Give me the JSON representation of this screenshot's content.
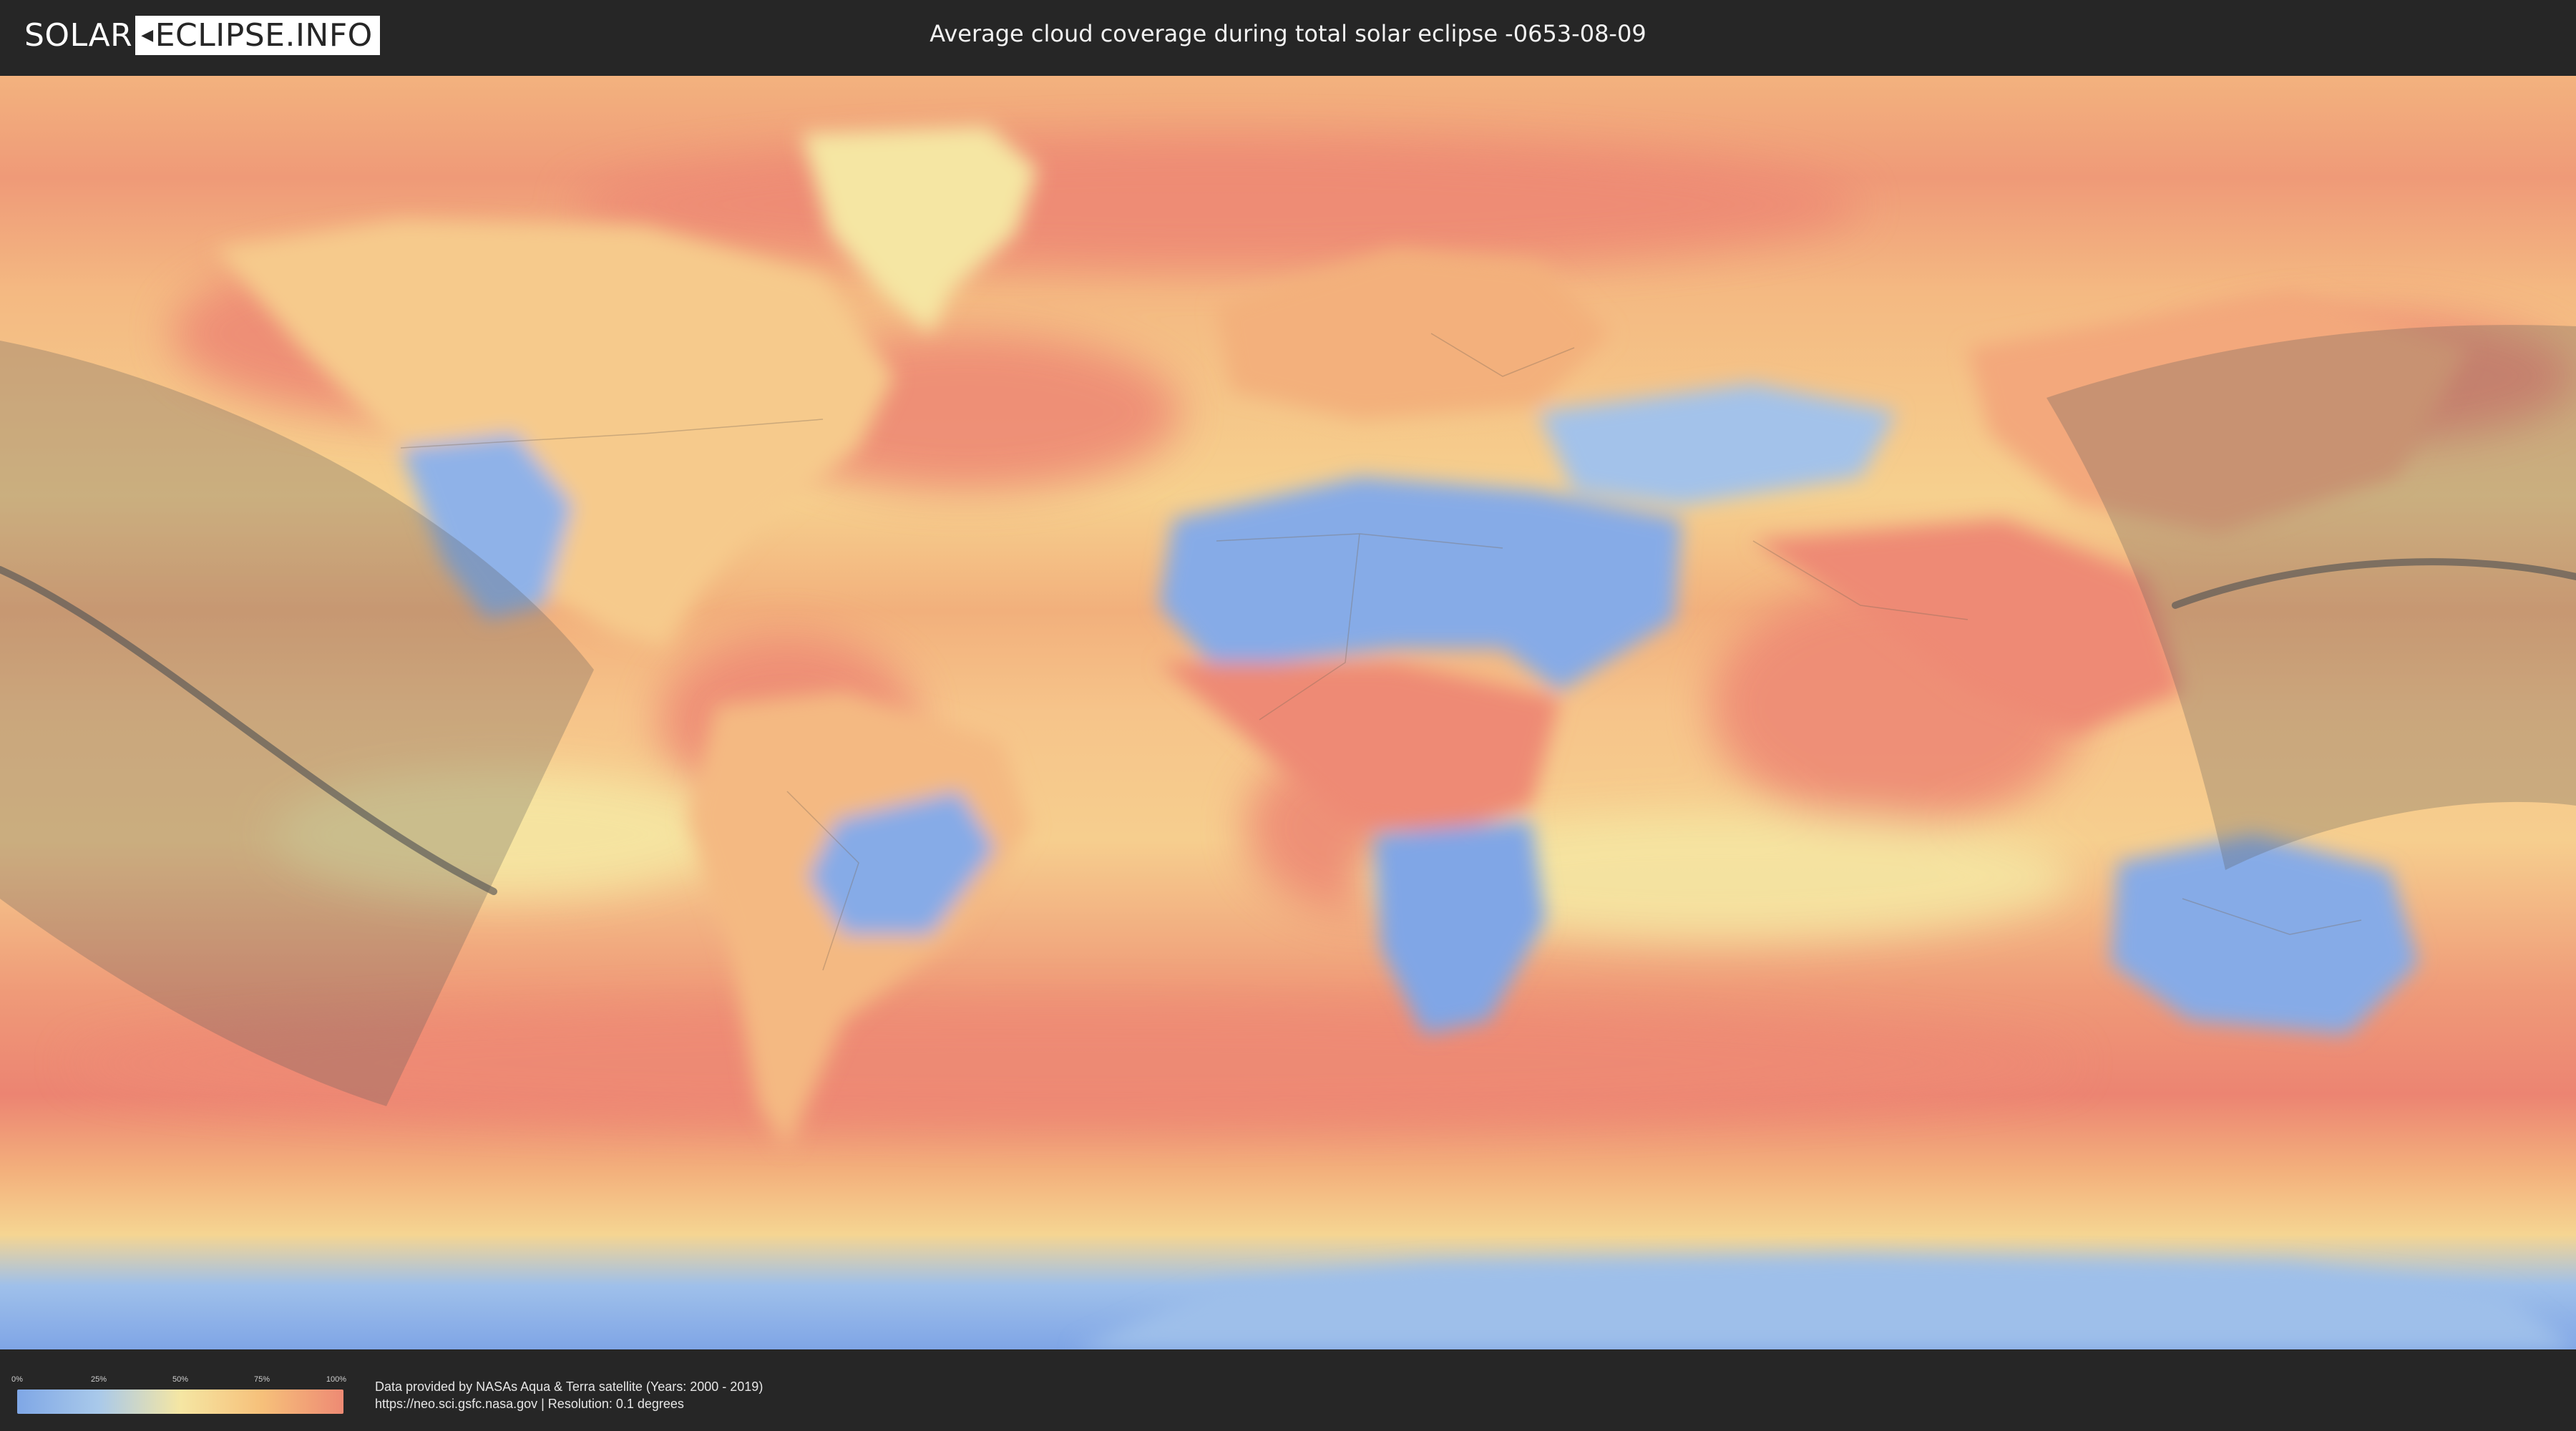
{
  "header": {
    "logo_left": "SOLAR",
    "logo_right": "ECLIPSE.INFO",
    "title": "Average cloud coverage during total solar eclipse -0653-08-09"
  },
  "legend": {
    "ticks": [
      {
        "label": "0%",
        "value": 0
      },
      {
        "label": "25%",
        "value": 25
      },
      {
        "label": "50%",
        "value": 50
      },
      {
        "label": "75%",
        "value": 75
      },
      {
        "label": "100%",
        "value": 100
      }
    ],
    "colors": [
      "#7fa7e6",
      "#a9c9ea",
      "#f5e6a3",
      "#f6c07a",
      "#ee8a74"
    ]
  },
  "footer": {
    "credit_line1": "Data provided by NASAs Aqua & Terra satellite (Years: 2000 - 2019)",
    "credit_line2": "https://neo.sci.gsfc.nasa.gov | Resolution: 0.1 degrees"
  },
  "map": {
    "type": "equirectangular world map",
    "colors": {
      "cloudy": "#ee8a74",
      "partly": "#f6c07a",
      "mixed": "#f5e6a3",
      "clear": "#7fa7e6",
      "clear_light": "#a9c9ea",
      "eclipse_band": "#5a5a5a",
      "central_line": "#555555"
    }
  }
}
